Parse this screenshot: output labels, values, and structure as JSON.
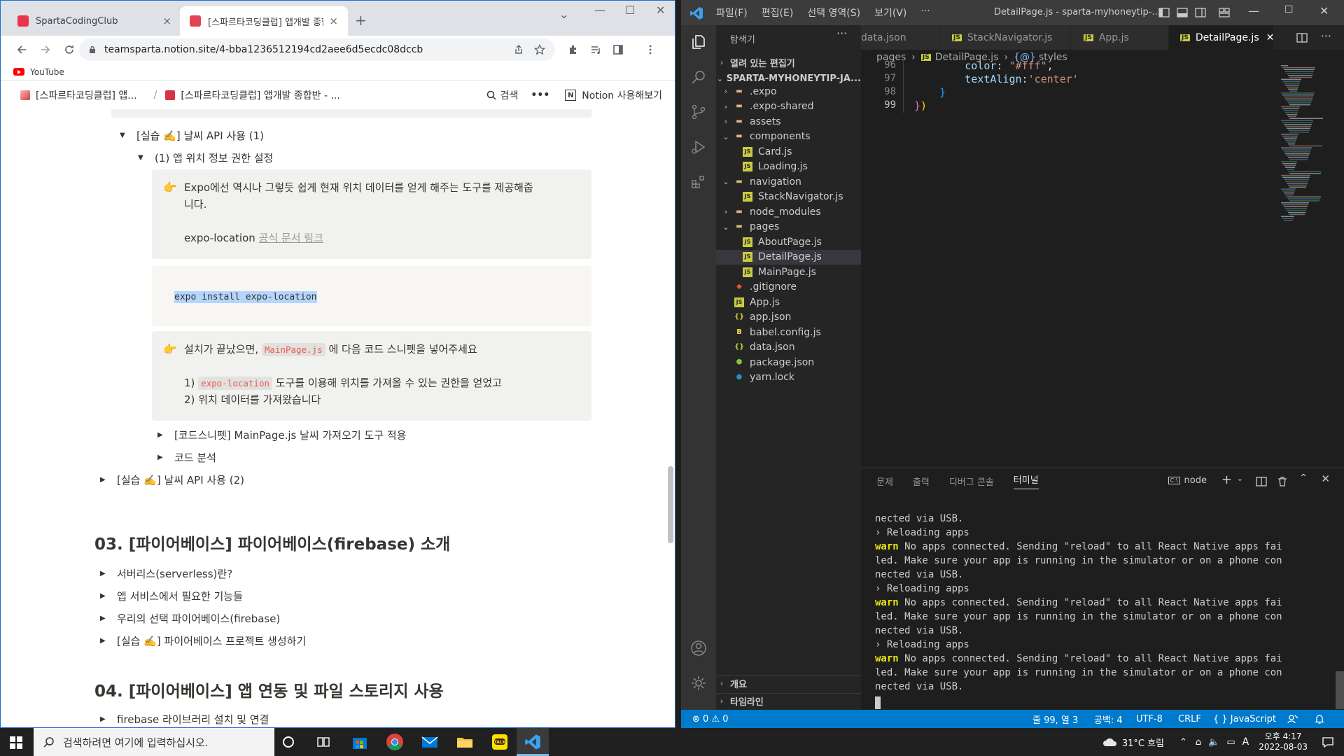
{
  "chrome": {
    "tabs": [
      {
        "title": "SpartaCodingClub",
        "close": "×"
      },
      {
        "title": "[스파르타코딩클럽] 앱개발 종합반",
        "close": "×"
      }
    ],
    "new_tab": "+",
    "url": "teamsparta.notion.site/4-bba1236512194cd2aee6d5ecdc08dccb",
    "bookmark": "YouTube"
  },
  "notion": {
    "breadcrumb": [
      "[스파르타코딩클럽] 앱...",
      "[스파르타코딩클럽] 앱개발 종합반 - ..."
    ],
    "search_label": "검색",
    "more": "•••",
    "try_notion": "Notion 사용해보기",
    "toggle_weather1": "[실습 ✍️] 날씨 API 사용 (1)",
    "toggle_location": "(1) 앱 위치 정보 권한 설정",
    "callout1_line1": "Expo에선 역시나 그렇듯 쉽게 현재 위치 데이터를 얻게 해주는 도구를 제공해줍",
    "callout1_line2": "니다.",
    "callout1_line3_prefix": "expo-location ",
    "callout1_link": "공식 문서 링크",
    "code_block": "expo install expo-location",
    "callout2_prefix": "설치가 끝났으면, ",
    "callout2_code": "MainPage.js",
    "callout2_suffix": " 에 다음 코드 스니펫을 넣어주세요",
    "callout2_line2_prefix": "1) ",
    "callout2_line2_code": "expo-location",
    "callout2_line2_suffix": " 도구를 이용해 위치를 가져올 수 있는 권한을 얻었고",
    "callout2_line3": "2) 위치 데이터를 가져왔습니다",
    "toggle_snippet": "[코드스니펫] MainPage.js 날씨 가져오기 도구 적용",
    "toggle_analysis": "코드 분석",
    "toggle_weather2": "[실습 ✍️] 날씨 API 사용 (2)",
    "h2_03": "03. [파이어베이스] 파이어베이스(firebase) 소개",
    "items_03": [
      "서버리스(serverless)란?",
      "앱 서비스에서 필요한 기능들",
      "우리의 선택 파이어베이스(firebase)",
      "[실습 ✍️] 파이어베이스 프로젝트 생성하기"
    ],
    "h2_04": "04. [파이어베이스] 앱 연동 및 파일 스토리지 사용",
    "items_04": [
      "firebase 라이브러리 설치 및 연결"
    ]
  },
  "vscode": {
    "menu": [
      "파일(F)",
      "편집(E)",
      "선택 영역(S)",
      "보기(V)",
      "···"
    ],
    "window_title": "DetailPage.js - sparta-myhoneytip-...",
    "explorer_title": "탐색기",
    "open_editors": "열려 있는 편집기",
    "project": "SPARTA-MYHONEYTIP-JA...",
    "tree": [
      {
        "label": ".expo",
        "type": "folder",
        "chev": "›",
        "indent": 1
      },
      {
        "label": ".expo-shared",
        "type": "folder",
        "chev": "›",
        "indent": 1
      },
      {
        "label": "assets",
        "type": "folder",
        "chev": "›",
        "indent": 1
      },
      {
        "label": "components",
        "type": "folder",
        "chev": "⌄",
        "indent": 1
      },
      {
        "label": "Card.js",
        "type": "js",
        "chev": "",
        "indent": 2
      },
      {
        "label": "Loading.js",
        "type": "js",
        "chev": "",
        "indent": 2
      },
      {
        "label": "navigation",
        "type": "folder",
        "chev": "⌄",
        "indent": 1
      },
      {
        "label": "StackNavigator.js",
        "type": "js",
        "chev": "",
        "indent": 2
      },
      {
        "label": "node_modules",
        "type": "folder",
        "chev": "›",
        "indent": 1
      },
      {
        "label": "pages",
        "type": "folder",
        "chev": "⌄",
        "indent": 1
      },
      {
        "label": "AboutPage.js",
        "type": "js",
        "chev": "",
        "indent": 2
      },
      {
        "label": "DetailPage.js",
        "type": "js",
        "chev": "",
        "indent": 2,
        "selected": true
      },
      {
        "label": "MainPage.js",
        "type": "js",
        "chev": "",
        "indent": 2
      },
      {
        "label": ".gitignore",
        "type": "git",
        "chev": "",
        "indent": 1
      },
      {
        "label": "App.js",
        "type": "js",
        "chev": "",
        "indent": 1
      },
      {
        "label": "app.json",
        "type": "json",
        "chev": "",
        "indent": 1
      },
      {
        "label": "babel.config.js",
        "type": "babel",
        "chev": "",
        "indent": 1
      },
      {
        "label": "data.json",
        "type": "json",
        "chev": "",
        "indent": 1
      },
      {
        "label": "package.json",
        "type": "npm",
        "chev": "",
        "indent": 1
      },
      {
        "label": "yarn.lock",
        "type": "yarn",
        "chev": "",
        "indent": 1
      }
    ],
    "outline": "개요",
    "timeline": "타임라인",
    "tabs": [
      {
        "label": "data.json",
        "icon": ""
      },
      {
        "label": "StackNavigator.js",
        "icon": "JS"
      },
      {
        "label": "App.js",
        "icon": "JS"
      },
      {
        "label": "DetailPage.js",
        "icon": "JS",
        "active": true
      }
    ],
    "breadcrumb": [
      "pages",
      "DetailPage.js",
      "styles"
    ],
    "code_lines": [
      {
        "n": "96",
        "text": "        color: \"#fff\","
      },
      {
        "n": "97",
        "text": "        textAlign:'center'"
      },
      {
        "n": "98",
        "text": "    }"
      },
      {
        "n": "99",
        "text": "})"
      }
    ],
    "panel_tabs": [
      "문제",
      "출력",
      "디버그 콘솔",
      "터미널"
    ],
    "panel_shell": "node",
    "terminal_lines": [
      {
        "warn": "",
        "text": "nected via USB."
      },
      {
        "warn": "",
        "text": "› Reloading apps"
      },
      {
        "warn": "warn",
        "text": " No apps connected. Sending \"reload\" to all React Native apps fai"
      },
      {
        "warn": "",
        "text": "led. Make sure your app is running in the simulator or on a phone con"
      },
      {
        "warn": "",
        "text": "nected via USB."
      },
      {
        "warn": "",
        "text": "› Reloading apps"
      },
      {
        "warn": "warn",
        "text": " No apps connected. Sending \"reload\" to all React Native apps fai"
      },
      {
        "warn": "",
        "text": "led. Make sure your app is running in the simulator or on a phone con"
      },
      {
        "warn": "",
        "text": "nected via USB."
      },
      {
        "warn": "",
        "text": "› Reloading apps"
      },
      {
        "warn": "warn",
        "text": " No apps connected. Sending \"reload\" to all React Native apps fai"
      },
      {
        "warn": "",
        "text": "led. Make sure your app is running in the simulator or on a phone con"
      },
      {
        "warn": "",
        "text": "nected via USB."
      }
    ],
    "status": {
      "problems": "⊗ 0 ⚠ 0",
      "position": "줄 99, 열 3",
      "spaces": "공백: 4",
      "encoding": "UTF-8",
      "eol": "CRLF",
      "language": "{ } JavaScript"
    }
  },
  "taskbar": {
    "search_placeholder": "검색하려면 여기에 입력하십시오.",
    "weather": "31°C 흐림",
    "ime": "A",
    "time": "오후 4:17",
    "date": "2022-08-03"
  },
  "colors": {
    "vscode_blue": "#007acc",
    "notion_red": "#eb5757",
    "callout_bg": "#f1f1ef"
  }
}
